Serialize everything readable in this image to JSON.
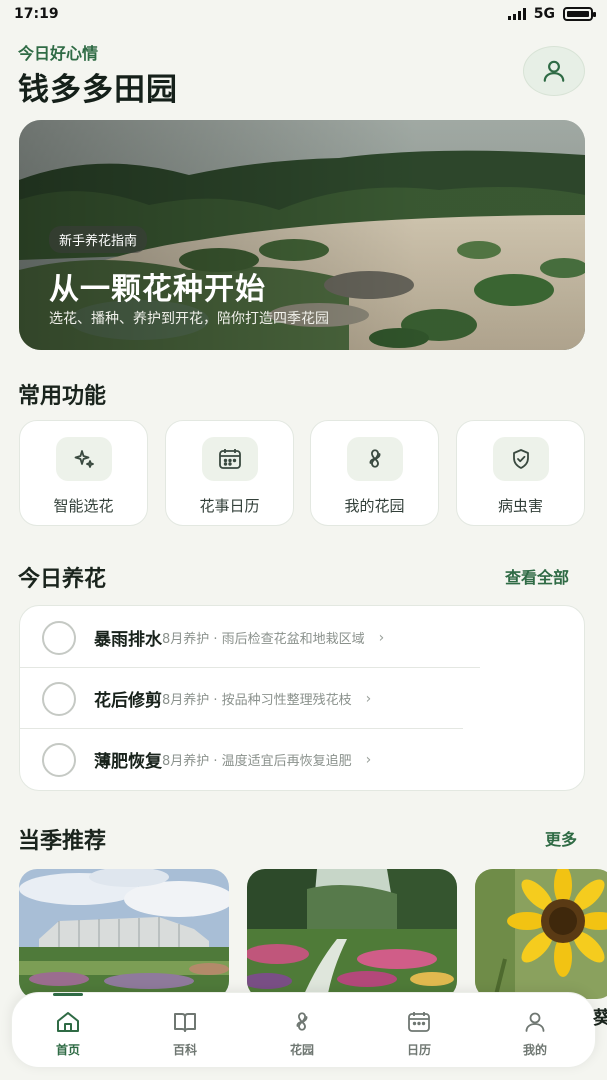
{
  "status_bar": {
    "time": "17:19",
    "network": "5G"
  },
  "header": {
    "greeting": "今日好心情",
    "title": "钱多多田园"
  },
  "hero": {
    "tag": "新手养花指南",
    "title": "从一颗花种开始",
    "subtitle": "选花、播种、养护到开花，陪你打造四季花园"
  },
  "functions": {
    "title": "常用功能",
    "items": [
      {
        "label": "智能选花",
        "icon": "sparkle-icon"
      },
      {
        "label": "花事日历",
        "icon": "calendar-icon"
      },
      {
        "label": "我的花园",
        "icon": "flower-icon"
      },
      {
        "label": "病虫害",
        "icon": "shield-icon"
      }
    ]
  },
  "today": {
    "title": "今日养花",
    "link": "查看全部",
    "tasks": [
      {
        "name": "暴雨排水",
        "meta": "8月养护 · 雨后检查花盆和地栽区域"
      },
      {
        "name": "花后修剪",
        "meta": "8月养护 · 按品种习性整理残花枝"
      },
      {
        "name": "薄肥恢复",
        "meta": "8月养护 · 温度适宜后再恢复追肥"
      }
    ]
  },
  "seasonal": {
    "title": "当季推荐",
    "link": "更多",
    "peek_text": "葵"
  },
  "tabs": [
    {
      "label": "首页",
      "icon": "home-icon",
      "active": true
    },
    {
      "label": "百科",
      "icon": "book-icon",
      "active": false
    },
    {
      "label": "花园",
      "icon": "flower-icon",
      "active": false
    },
    {
      "label": "日历",
      "icon": "calendar-icon",
      "active": false
    },
    {
      "label": "我的",
      "icon": "user-icon",
      "active": false
    }
  ],
  "colors": {
    "accent": "#2f6b45",
    "background": "#f4f5f0",
    "card": "#ffffff"
  }
}
